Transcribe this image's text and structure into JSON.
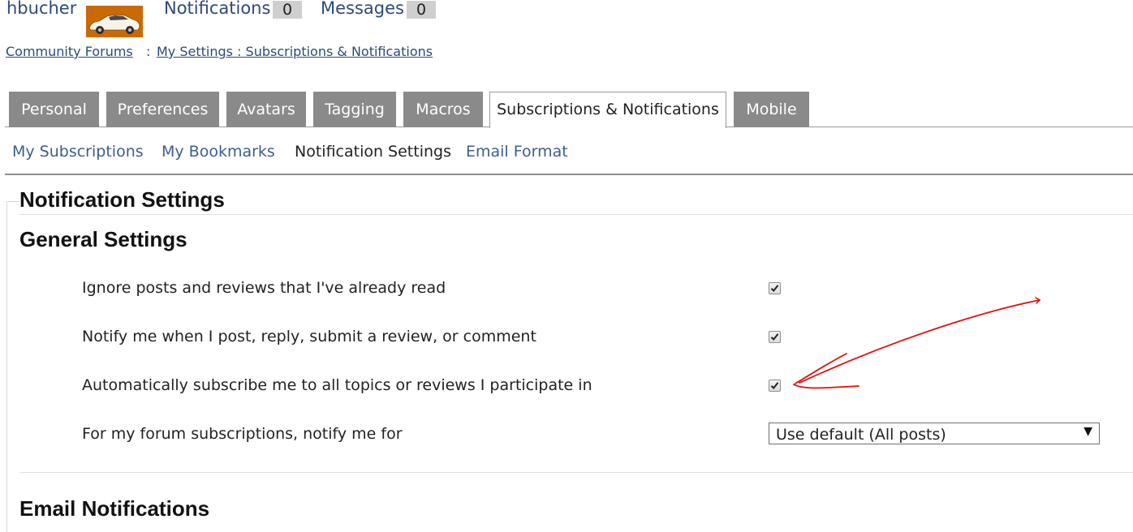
{
  "header": {
    "username": "hbucher",
    "notifications_label": "Notifications",
    "notifications_count": "0",
    "messages_label": "Messages",
    "messages_count": "0"
  },
  "breadcrumb": {
    "home": "Community Forums",
    "separator": ":",
    "current": "My Settings : Subscriptions & Notifications"
  },
  "tabs": [
    {
      "label": "Personal"
    },
    {
      "label": "Preferences"
    },
    {
      "label": "Avatars"
    },
    {
      "label": "Tagging"
    },
    {
      "label": "Macros"
    },
    {
      "label": "Subscriptions & Notifications",
      "active": true
    },
    {
      "label": "Mobile"
    }
  ],
  "subnav": [
    {
      "label": "My Subscriptions"
    },
    {
      "label": "My Bookmarks"
    },
    {
      "label": "Notification Settings",
      "current": true
    },
    {
      "label": "Email Format"
    }
  ],
  "page_title": "Notification Settings",
  "general": {
    "heading": "General Settings",
    "settings": [
      {
        "label": "Ignore posts and reviews that I've already read",
        "checked": true
      },
      {
        "label": "Notify me when I post, reply, submit a review, or comment",
        "checked": true
      },
      {
        "label": "Automatically subscribe me to all topics or reviews I participate in",
        "checked": true
      }
    ],
    "forum_notify": {
      "label": "For my forum subscriptions, notify me for",
      "selected": "Use default (All posts)"
    }
  },
  "email": {
    "heading": "Email Notifications"
  },
  "colors": {
    "link": "#2d4a7a",
    "tab_inactive": "#8a8a8a",
    "annotation": "#e01010"
  },
  "icons": {
    "avatar": "sports-car-avatar",
    "checkbox": "checkmark-icon",
    "select_arrow": "triangle-down-icon",
    "annotation": "red-hand-drawn-arrow"
  }
}
